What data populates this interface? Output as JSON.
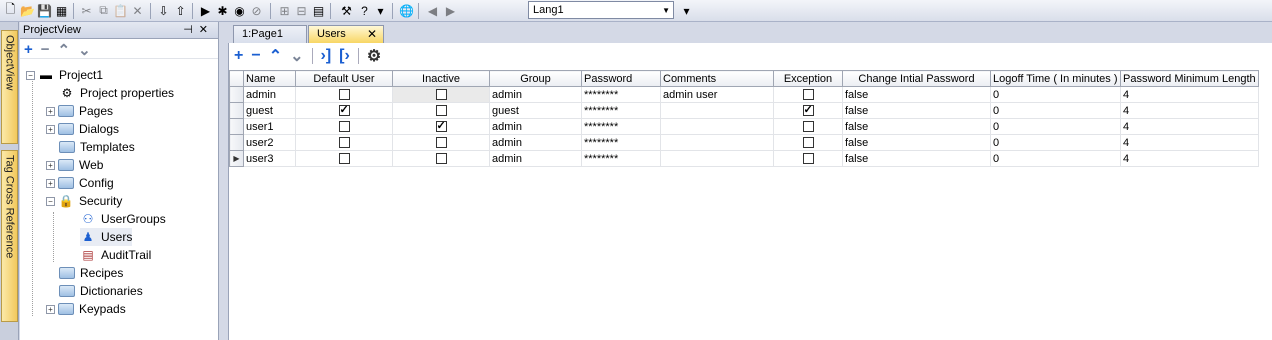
{
  "toolbar": {
    "language": "Lang1"
  },
  "side_tabs": [
    "ObjectView",
    "Tag Cross Reference"
  ],
  "project_view": {
    "title": "ProjectView",
    "tree": [
      {
        "label": "Project1",
        "level": 0,
        "icon": "project-icon"
      },
      {
        "label": "Project properties",
        "level": 1,
        "icon": "properties-icon"
      },
      {
        "label": "Pages",
        "level": 1,
        "icon": "folder-icon"
      },
      {
        "label": "Dialogs",
        "level": 1,
        "icon": "folder-icon"
      },
      {
        "label": "Templates",
        "level": 1,
        "icon": "folder-icon"
      },
      {
        "label": "Web",
        "level": 1,
        "icon": "folder-icon"
      },
      {
        "label": "Config",
        "level": 1,
        "icon": "folder-icon"
      },
      {
        "label": "Security",
        "level": 1,
        "icon": "lock-icon"
      },
      {
        "label": "UserGroups",
        "level": 2,
        "icon": "usergroups-icon"
      },
      {
        "label": "Users",
        "level": 2,
        "icon": "user-icon"
      },
      {
        "label": "AuditTrail",
        "level": 2,
        "icon": "audittrail-icon"
      },
      {
        "label": "Recipes",
        "level": 1,
        "icon": "folder-icon"
      },
      {
        "label": "Dictionaries",
        "level": 1,
        "icon": "folder-icon"
      },
      {
        "label": "Keypads",
        "level": 1,
        "icon": "folder-icon"
      }
    ]
  },
  "tabs": [
    {
      "label": "1:Page1"
    },
    {
      "label": "Users",
      "active": true
    }
  ],
  "users_table": {
    "columns": [
      "Name",
      "Default User",
      "Inactive",
      "Group",
      "Password",
      "Comments",
      "Exception",
      "Change Intial Password",
      "Logoff Time ( In minutes )",
      "Password Minimum Length"
    ],
    "rows": [
      {
        "name": "admin",
        "default_user": false,
        "inactive": false,
        "group": "admin",
        "password": "********",
        "comments": "admin user",
        "exception": false,
        "change_initial_password": "false",
        "logoff_time": "0",
        "password_min_length": "4"
      },
      {
        "name": "guest",
        "default_user": true,
        "inactive": false,
        "group": "guest",
        "password": "********",
        "comments": "",
        "exception": true,
        "change_initial_password": "false",
        "logoff_time": "0",
        "password_min_length": "4"
      },
      {
        "name": "user1",
        "default_user": false,
        "inactive": true,
        "group": "admin",
        "password": "********",
        "comments": "",
        "exception": false,
        "change_initial_password": "false",
        "logoff_time": "0",
        "password_min_length": "4"
      },
      {
        "name": "user2",
        "default_user": false,
        "inactive": false,
        "group": "admin",
        "password": "********",
        "comments": "",
        "exception": false,
        "change_initial_password": "false",
        "logoff_time": "0",
        "password_min_length": "4"
      },
      {
        "name": "user3",
        "default_user": false,
        "inactive": false,
        "group": "admin",
        "password": "********",
        "comments": "",
        "exception": false,
        "change_initial_password": "false",
        "logoff_time": "0",
        "password_min_length": "4"
      }
    ]
  },
  "colors": {
    "accent": "#1b5fd1",
    "active_tab": "#f8d664"
  }
}
